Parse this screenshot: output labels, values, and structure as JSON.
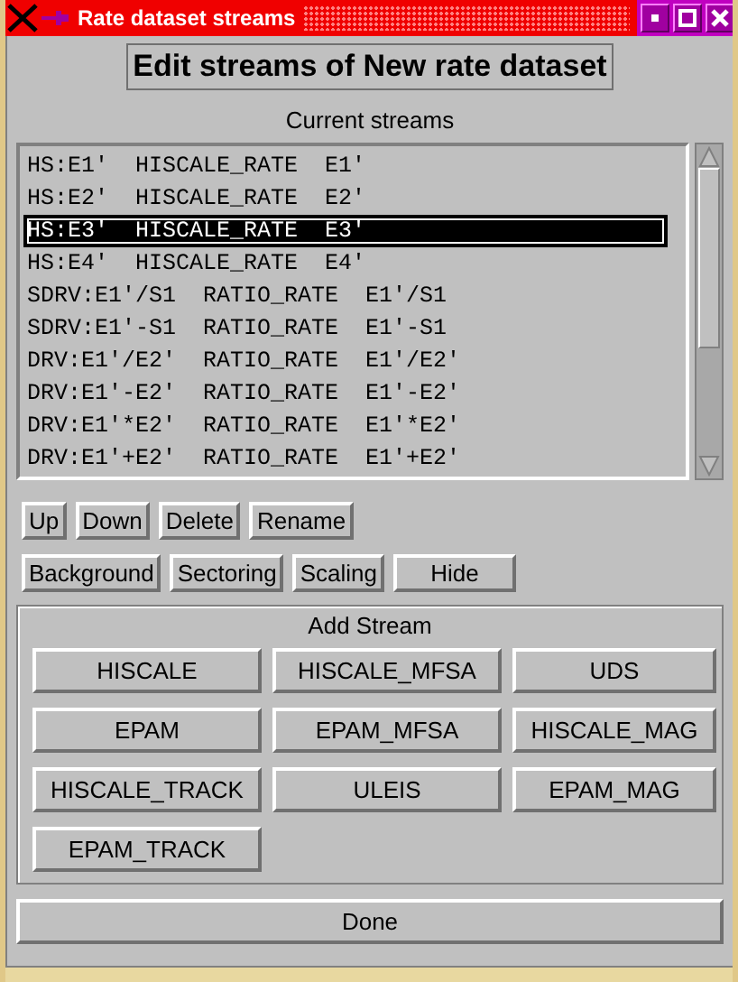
{
  "window": {
    "title": "Rate dataset streams"
  },
  "heading": "Edit streams of New rate dataset",
  "streams_label": "Current streams",
  "streams": [
    {
      "text": "HS:E1'  HISCALE_RATE  E1'",
      "selected": false
    },
    {
      "text": "HS:E2'  HISCALE_RATE  E2'",
      "selected": false
    },
    {
      "text": "HS:E3'  HISCALE_RATE  E3'",
      "selected": true
    },
    {
      "text": "HS:E4'  HISCALE_RATE  E4'",
      "selected": false
    },
    {
      "text": "SDRV:E1'/S1  RATIO_RATE  E1'/S1",
      "selected": false
    },
    {
      "text": "SDRV:E1'-S1  RATIO_RATE  E1'-S1",
      "selected": false
    },
    {
      "text": "DRV:E1'/E2'  RATIO_RATE  E1'/E2'",
      "selected": false
    },
    {
      "text": "DRV:E1'-E2'  RATIO_RATE  E1'-E2'",
      "selected": false
    },
    {
      "text": "DRV:E1'*E2'  RATIO_RATE  E1'*E2'",
      "selected": false
    },
    {
      "text": "DRV:E1'+E2'  RATIO_RATE  E1'+E2'",
      "selected": false
    }
  ],
  "edit_buttons": [
    "Up",
    "Down",
    "Delete",
    "Rename"
  ],
  "option_buttons": [
    "Background",
    "Sectoring",
    "Scaling",
    "Hide"
  ],
  "add_stream": {
    "title": "Add Stream",
    "buttons": [
      "HISCALE",
      "HISCALE_MFSA",
      "UDS",
      "EPAM",
      "EPAM_MFSA",
      "HISCALE_MAG",
      "HISCALE_TRACK",
      "ULEIS",
      "EPAM_MAG",
      "EPAM_TRACK"
    ]
  },
  "done_button": "Done"
}
